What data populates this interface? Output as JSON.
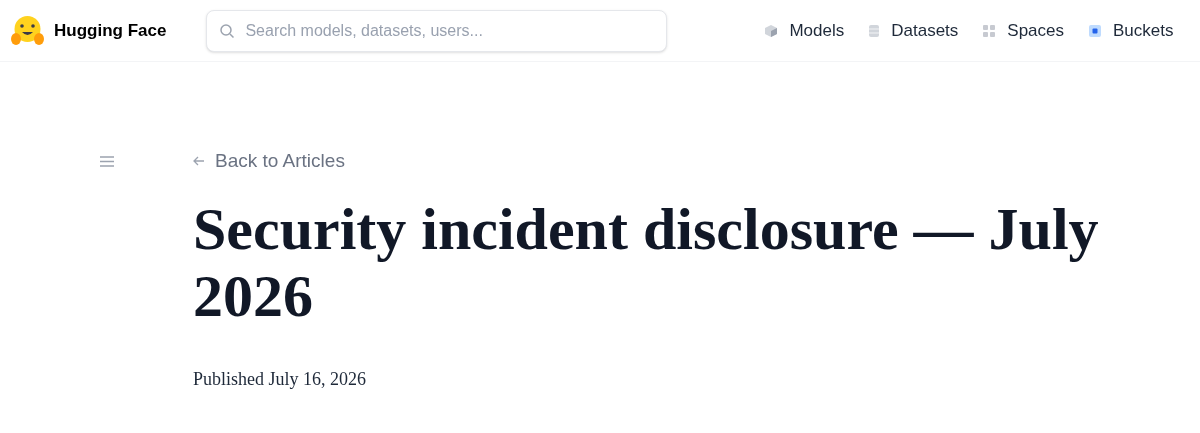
{
  "header": {
    "brand": "Hugging Face",
    "search": {
      "placeholder": "Search models, datasets, users..."
    },
    "nav": [
      {
        "kind": "models",
        "label": "Models"
      },
      {
        "kind": "datasets",
        "label": "Datasets"
      },
      {
        "kind": "spaces",
        "label": "Spaces"
      },
      {
        "kind": "buckets",
        "label": "Buckets"
      }
    ]
  },
  "article": {
    "back_link": "Back to Articles",
    "title": "Security incident disclosure — July 2026",
    "published": "Published July 16, 2026"
  }
}
